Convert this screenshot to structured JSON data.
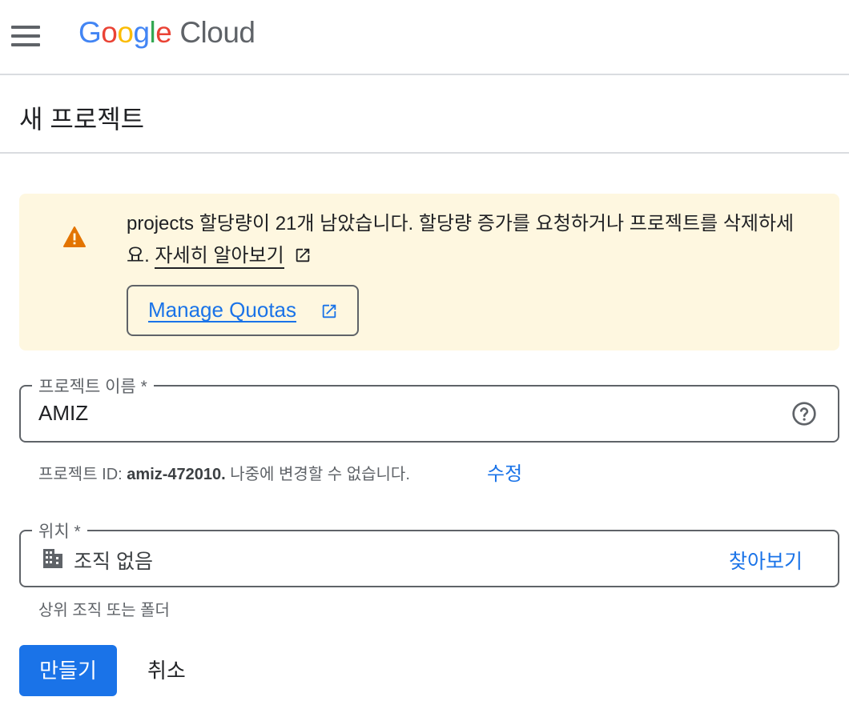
{
  "header": {
    "brand_google_letters": [
      "G",
      "o",
      "o",
      "g",
      "l",
      "e"
    ],
    "brand_colors": [
      "#4285f4",
      "#ea4335",
      "#fbbc04",
      "#4285f4",
      "#34a853",
      "#ea4335"
    ],
    "brand_product": "Cloud"
  },
  "page": {
    "title": "새 프로젝트"
  },
  "banner": {
    "message": "projects 할당량이 21개 남았습니다. 할당량 증가를 요청하거나 프로젝트를 삭제하세요.",
    "learn_more": "자세히 알아보기",
    "manage_button": "Manage Quotas",
    "background": "#fef7e0",
    "icon": "warning-icon"
  },
  "project_name": {
    "label": "프로젝트 이름 *",
    "value": "AMIZ"
  },
  "project_id_hint": {
    "prefix": "프로젝트 ID: ",
    "id": "amiz-472010.",
    "suffix": " 나중에 변경할 수 없습니다.",
    "edit_label": "수정"
  },
  "location": {
    "label": "위치 *",
    "value": "조직 없음",
    "browse_label": "찾아보기",
    "hint": "상위 조직 또는 폴더"
  },
  "actions": {
    "create_label": "만들기",
    "cancel_label": "취소",
    "primary_color": "#1a73e8"
  }
}
